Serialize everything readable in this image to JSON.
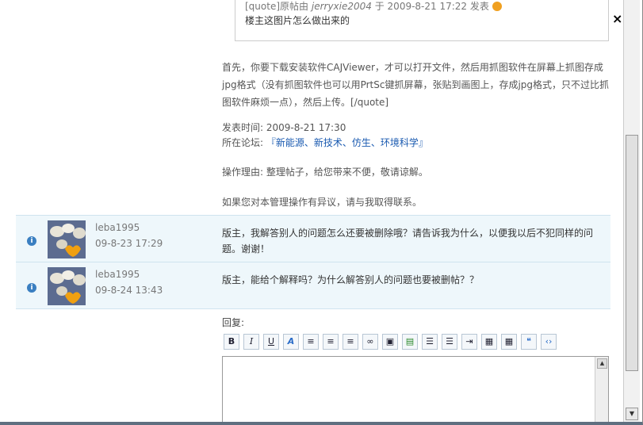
{
  "quote": {
    "prefix": "[quote]原帖由",
    "author": "jerryxie2004",
    "middle": "于 2009-8-21 17:22 发表",
    "text": "楼主这图片怎么做出来的"
  },
  "body_text": "首先，你要下载安装软件CAJViewer，才可以打开文件，然后用抓图软件在屏幕上抓图存成jpg格式（没有抓图软件也可以用PrtSc键抓屏幕，张贴到画图上，存成jpg格式，只不过比抓图软件麻烦一点），然后上传。[/quote]",
  "post_time": "发表时间: 2009-8-21 17:30",
  "forum_label": "所在论坛: ",
  "forum_link": "『新能源、新技术、仿生、环境科学』",
  "reason": "操作理由: 整理帖子，给您带来不便，敬请谅解。",
  "contact": "如果您对本管理操作有异议，请与我取得联系。",
  "rows": [
    {
      "name": "leba1995",
      "date": "09-8-23 17:29",
      "message": "版主，我解答别人的问题怎么还要被删除哦？请告诉我为什么，以便我以后不犯同样的问题。谢谢！"
    },
    {
      "name": "leba1995",
      "date": "09-8-24 13:43",
      "message": "版主，能给个解释吗？为什么解答别人的问题也要被删帖？？"
    }
  ],
  "reply_label": "回复:",
  "toolbar": [
    "B",
    "I",
    "U",
    "A",
    "left",
    "center",
    "right",
    "link",
    "image",
    "insert",
    "ol",
    "ul",
    "indent",
    "img-left",
    "img-right",
    "quote",
    "code"
  ],
  "close_glyph": "×"
}
